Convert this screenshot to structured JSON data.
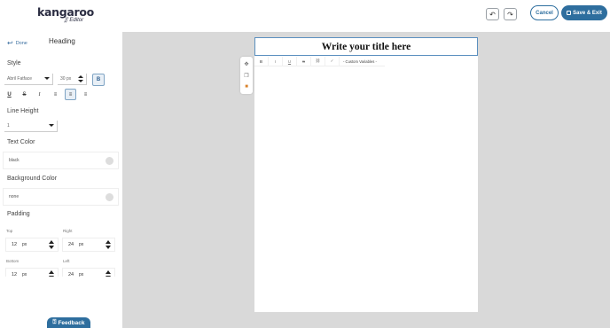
{
  "header": {
    "logo_text": "kangaroo",
    "logo_sub": "Editor",
    "undo_icon": "undo-icon",
    "redo_icon": "redo-icon",
    "cancel_label": "Cancel",
    "save_label": "Save & Exit"
  },
  "sidebar": {
    "done_label": "Done",
    "title": "Heading",
    "style_label": "Style",
    "font_family_value": "Abril Fatface",
    "font_size_value": "30 px",
    "bold_label": "B",
    "format_buttons": [
      "U",
      "S",
      "I",
      "≡",
      "≡",
      "≡"
    ],
    "line_height_label": "Line Height",
    "line_height_value": "1",
    "text_color_label": "Text Color",
    "text_color_value": "black",
    "bg_color_label": "Background Color",
    "bg_color_value": "none",
    "padding_label": "Padding",
    "padding": {
      "top_label": "Top",
      "top_value": "12",
      "right_label": "Right",
      "right_value": "24",
      "bottom_label": "Bottom",
      "bottom_value": "12",
      "left_label": "Left",
      "left_value": "24",
      "unit": "px"
    },
    "feedback_label": "Feedback"
  },
  "canvas": {
    "heading_text": "Write your title here",
    "toolbar": {
      "buttons": [
        "B",
        "I",
        "U",
        "S",
        "⛓",
        "✓"
      ],
      "variables_label": "- Custom Variables -"
    }
  },
  "colors": {
    "accent": "#2e6e9e",
    "canvas_bg": "#d9d9d9",
    "selection_border": "#5b8fbf"
  }
}
